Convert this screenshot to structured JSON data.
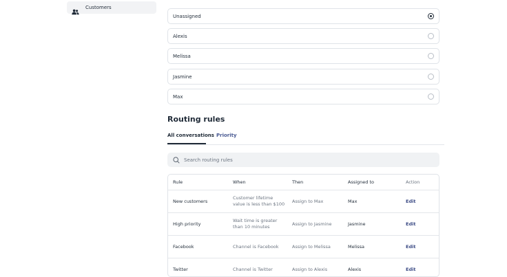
{
  "sidebar": {
    "items": [
      {
        "label": "Customers",
        "icon": "users-icon"
      }
    ]
  },
  "assignees": [
    {
      "name": "Unassigned",
      "selected": true
    },
    {
      "name": "Alexis",
      "selected": false
    },
    {
      "name": "Melissa",
      "selected": false
    },
    {
      "name": "Jasmine",
      "selected": false
    },
    {
      "name": "Max",
      "selected": false
    }
  ],
  "routing": {
    "title": "Routing rules",
    "tabs": [
      {
        "label": "All conversations",
        "active": true
      },
      {
        "label": "Priority",
        "active": false
      }
    ],
    "search": {
      "placeholder": "Search routing rules",
      "value": ""
    },
    "table": {
      "headers": [
        "Rule",
        "When",
        "Then",
        "Assigned to",
        "Action"
      ],
      "rows": [
        {
          "rule": "New customers",
          "when": "Customer lifetime value is less than $100",
          "then": "Assign to Max",
          "assigned": "Max",
          "action": "Edit"
        },
        {
          "rule": "High priority",
          "when": "Wait time is greater than 10 minutes",
          "then": "Assign to Jasmine",
          "assigned": "Jasmine",
          "action": "Edit"
        },
        {
          "rule": "Facebook",
          "when": "Channel is Facebook",
          "then": "Assign to Melissa",
          "assigned": "Melissa",
          "action": "Edit"
        },
        {
          "rule": "Twitter",
          "when": "Channel is Twitter",
          "then": "Assign to Alexis",
          "assigned": "Alexis",
          "action": "Edit"
        }
      ]
    }
  },
  "colors": {
    "text": "#1f2a37",
    "muted": "#6b7480",
    "accent": "#3b4a84",
    "border": "#dfe3e8",
    "search_bg": "#f0f2f4"
  }
}
